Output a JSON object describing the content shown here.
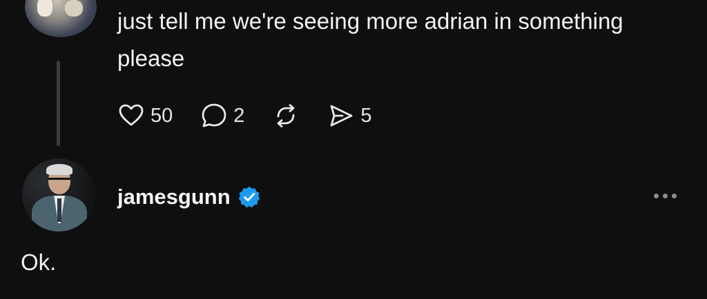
{
  "reply_post": {
    "text": "just tell me we're seeing more adrian in something please",
    "actions": {
      "likes": "50",
      "comments": "2",
      "shares": "5"
    }
  },
  "main_post": {
    "username": "jamesgunn",
    "verified": true,
    "text": "Ok."
  },
  "colors": {
    "background": "#0f0f0f",
    "text": "#f3f3f3",
    "verified_blue": "#1d9bf0",
    "muted": "#8c8c8c"
  },
  "icons": {
    "like": "heart-icon",
    "comment": "comment-bubble-icon",
    "repost": "repost-icon",
    "share": "send-icon",
    "verified": "verified-badge-icon",
    "more": "more-dots-icon"
  }
}
